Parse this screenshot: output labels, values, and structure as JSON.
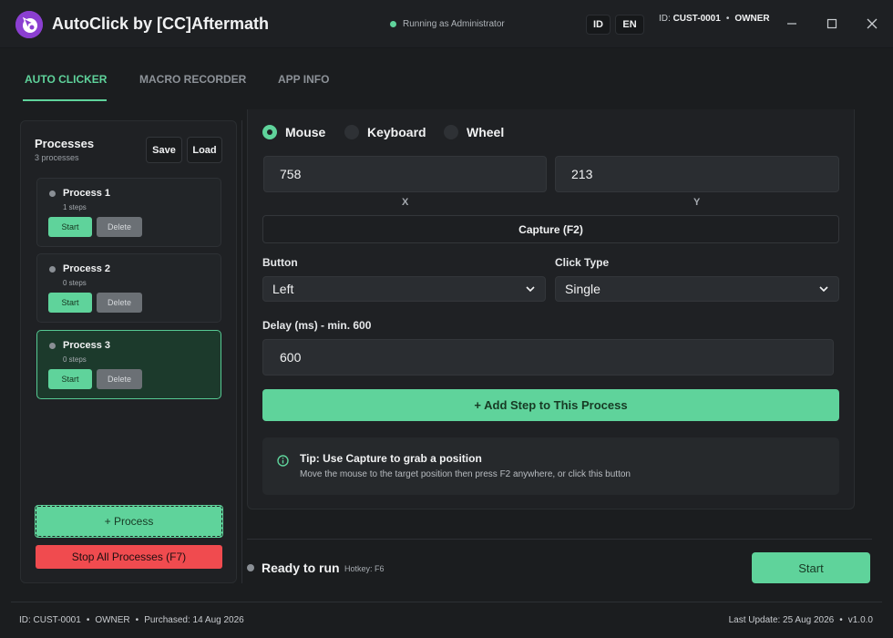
{
  "app": {
    "title": "AutoClick by [CC]Aftermath",
    "status": "Running as Administrator",
    "languages": [
      "ID",
      "EN"
    ],
    "customer_id_label": "ID:",
    "customer_id": "CUST-0001",
    "role": "OWNER",
    "separator": "•"
  },
  "tabs": [
    {
      "label": "AUTO CLICKER",
      "active": true
    },
    {
      "label": "MACRO RECORDER",
      "active": false
    },
    {
      "label": "APP INFO",
      "active": false
    }
  ],
  "processes_panel": {
    "title": "Processes",
    "count_text": "3 processes",
    "save_label": "Save",
    "load_label": "Load",
    "items": [
      {
        "name": "Process 1",
        "steps": "1 steps",
        "start": "Start",
        "delete": "Delete",
        "selected": false
      },
      {
        "name": "Process 2",
        "steps": "0 steps",
        "start": "Start",
        "delete": "Delete",
        "selected": false
      },
      {
        "name": "Process 3",
        "steps": "0 steps",
        "start": "Start",
        "delete": "Delete",
        "selected": true
      }
    ],
    "add_label": "+ Process",
    "stop_all_label": "Stop All Processes (F7)"
  },
  "editor": {
    "input_types": [
      {
        "label": "Mouse",
        "selected": true
      },
      {
        "label": "Keyboard",
        "selected": false
      },
      {
        "label": "Wheel",
        "selected": false
      }
    ],
    "x_value": "758",
    "y_value": "213",
    "x_label": "X",
    "y_label": "Y",
    "capture_label": "Capture (F2)",
    "button_label": "Button",
    "button_value": "Left",
    "click_type_label": "Click Type",
    "click_type_value": "Single",
    "delay_label": "Delay (ms) - min. 600",
    "delay_value": "600",
    "add_step_label": "+ Add Step to This Process",
    "tip_title": "Tip: Use Capture to grab a position",
    "tip_body": "Move the mouse to the target position then press F2 anywhere, or click this button"
  },
  "status_bar": {
    "status": "Ready to run",
    "hotkey": "Hotkey: F6",
    "start_label": "Start"
  },
  "footer": {
    "id_text": "ID: CUST-0001",
    "role": "OWNER",
    "purchased": "Purchased: 14 Aug 2026",
    "last_update": "Last Update: 25 Aug 2026",
    "version": "v1.0.0",
    "separator": "•"
  },
  "colors": {
    "accent": "#5fd39b",
    "danger": "#f04b4f",
    "background": "#1b1d1f",
    "logo": "#8b3fd1"
  }
}
